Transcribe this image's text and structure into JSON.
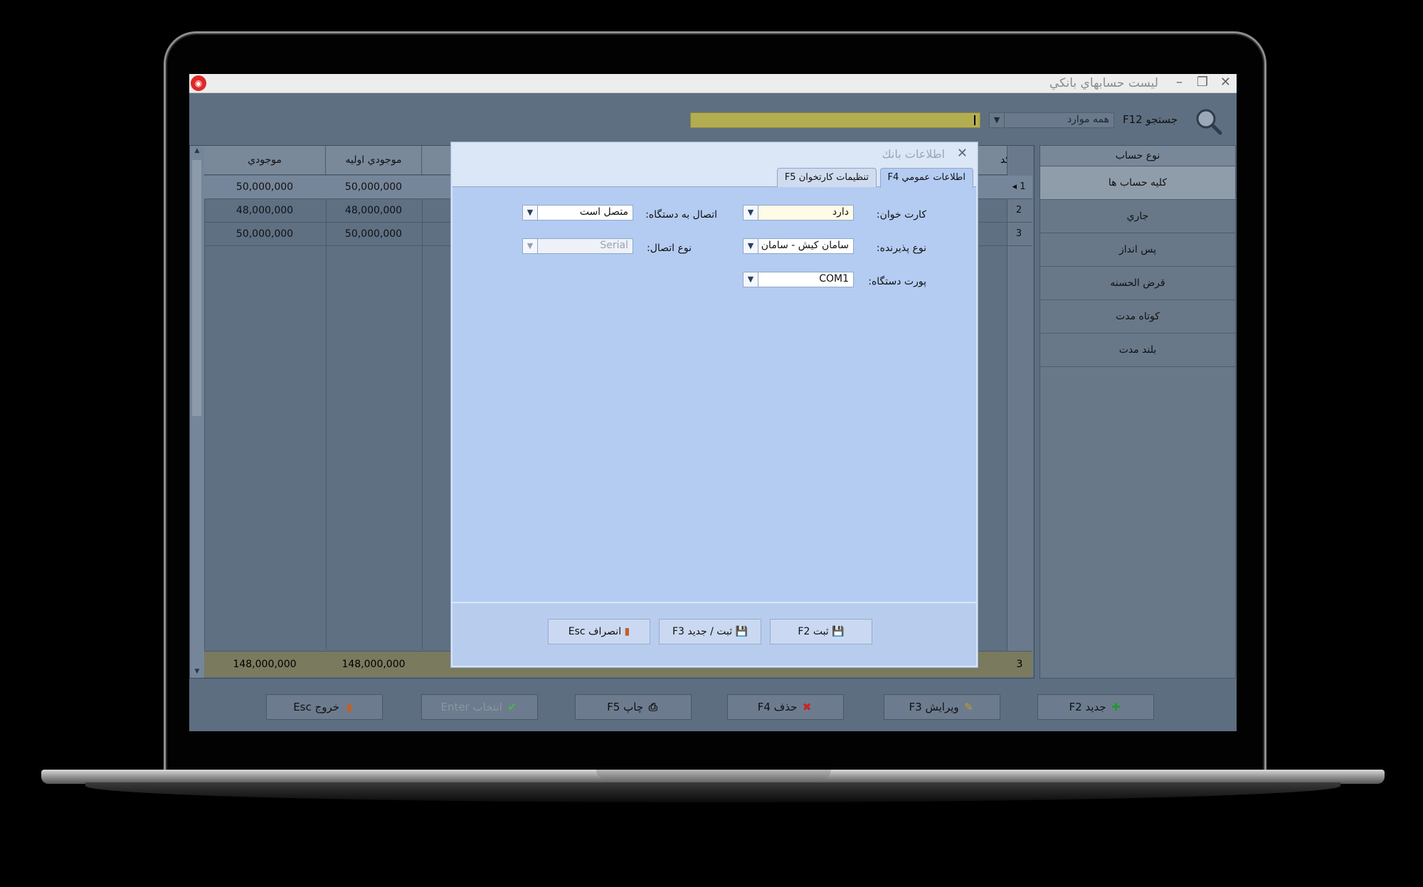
{
  "window": {
    "title": "ليست حسابهاي بانكي",
    "logo": "app-logo-icon"
  },
  "search": {
    "label": "جستجو F12",
    "filter_value": "همه موارد",
    "query": ""
  },
  "account_types": {
    "header": "نوع حساب",
    "items": [
      "كليه حساب ها",
      "جاري",
      "پس انداز",
      "قرض الحسنه",
      "كوتاه مدت",
      "بلند مدت"
    ]
  },
  "grid": {
    "columns": {
      "balance": "موجودي",
      "initial_balance": "موجودي اوليه",
      "code": "كد"
    },
    "rows": [
      {
        "num": "1",
        "balance": "50,000,000",
        "initial": "50,000,000"
      },
      {
        "num": "2",
        "balance": "48,000,000",
        "initial": "48,000,000"
      },
      {
        "num": "3",
        "balance": "50,000,000",
        "initial": "50,000,000"
      }
    ],
    "footer": {
      "count": "3",
      "balance_total": "148,000,000",
      "initial_total": "148,000,000"
    }
  },
  "toolbar": {
    "new": "جديد F2",
    "edit": "ويرايش F3",
    "delete": "حذف F4",
    "print": "چاپ F5",
    "select": "انتخاب Enter",
    "exit": "خروج Esc"
  },
  "dialog": {
    "title": "اطلاعات بانك",
    "tabs": [
      "اطلاعات عمومي F4",
      "تنظيمات كارتخوان F5"
    ],
    "fields": {
      "card_reader_label": "كارت خوان:",
      "card_reader_value": "دارد",
      "acceptor_type_label": "نوع پذيرنده:",
      "acceptor_type_value": "سامان كيش - سامان",
      "device_port_label": "پورت دستگاه:",
      "device_port_value": "COM1",
      "device_connection_label": "اتصال به دستگاه:",
      "device_connection_value": "متصل است",
      "connection_type_label": "نوع اتصال:",
      "connection_type_value": "Serial"
    },
    "buttons": {
      "save": "ثبت F2",
      "save_new": "ثبت / جديد F3",
      "cancel": "انصراف Esc"
    }
  },
  "colors": {
    "screen_bg": "#5e6f82",
    "dialog_bg": "#b4ccf2",
    "search_field": "#b3ad52",
    "accent_red": "#e02828"
  }
}
